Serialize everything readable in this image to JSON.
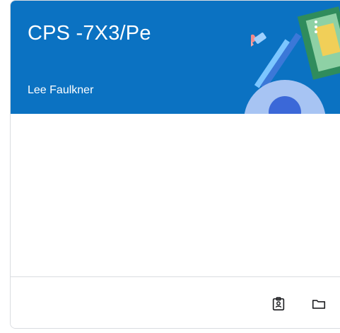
{
  "class_card": {
    "title": "CPS -7X3/Pe",
    "teacher": "Lee Faulkner",
    "header_color": "#0b72c2"
  },
  "actions": {
    "more_icon": "more-vertical-icon",
    "work_icon": "assignment-ind-icon",
    "folder_icon": "folder-icon"
  }
}
